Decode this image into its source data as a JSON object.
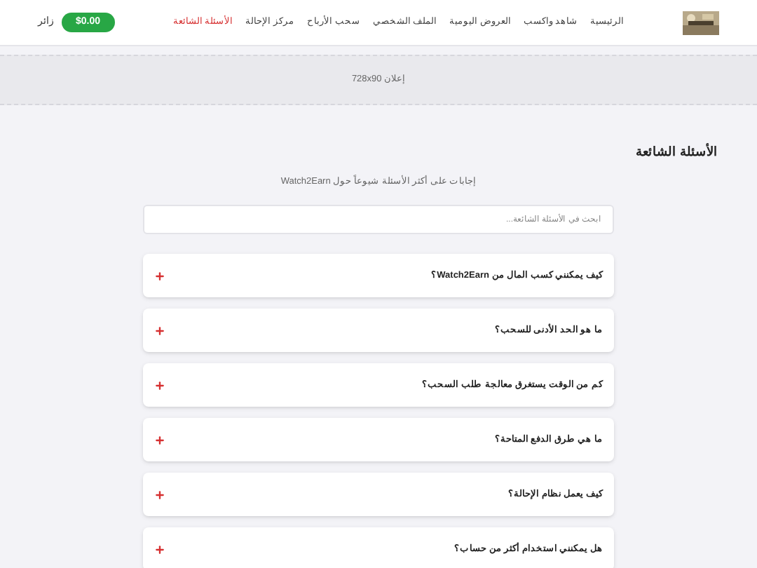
{
  "nav": {
    "items": [
      {
        "label": "الرئيسية",
        "selected": false
      },
      {
        "label": "شاهد واكسب",
        "selected": false
      },
      {
        "label": "العروض اليومية",
        "selected": false
      },
      {
        "label": "الملف الشخصي",
        "selected": false
      },
      {
        "label": "سحب الأرباح",
        "selected": false
      },
      {
        "label": "مركز الإحالة",
        "selected": false
      },
      {
        "label": "الأسئلة الشائعة",
        "selected": true
      }
    ],
    "balance": "$0.00",
    "user": "زائر"
  },
  "ad": "إعلان 728x90",
  "title": "الأسئلة الشائعة",
  "subtitle": "إجابات على أكثر الأسئلة شيوعاً حول Watch2Earn",
  "search": {
    "placeholder": "ابحث في الأسئلة الشائعة..."
  },
  "faqs": [
    {
      "question": "كيف يمكنني كسب المال من Watch2Earn؟",
      "expanded": false
    },
    {
      "question": "ما هو الحد الأدنى للسحب؟",
      "expanded": false
    },
    {
      "question": "كم من الوقت يستغرق معالجة طلب السحب؟",
      "expanded": false
    },
    {
      "question": "ما هي طرق الدفع المتاحة؟",
      "expanded": false
    },
    {
      "question": "كيف يعمل نظام الإحالة؟",
      "expanded": false
    },
    {
      "question": "هل يمكنني استخدام أكثر من حساب؟",
      "expanded": false
    }
  ]
}
